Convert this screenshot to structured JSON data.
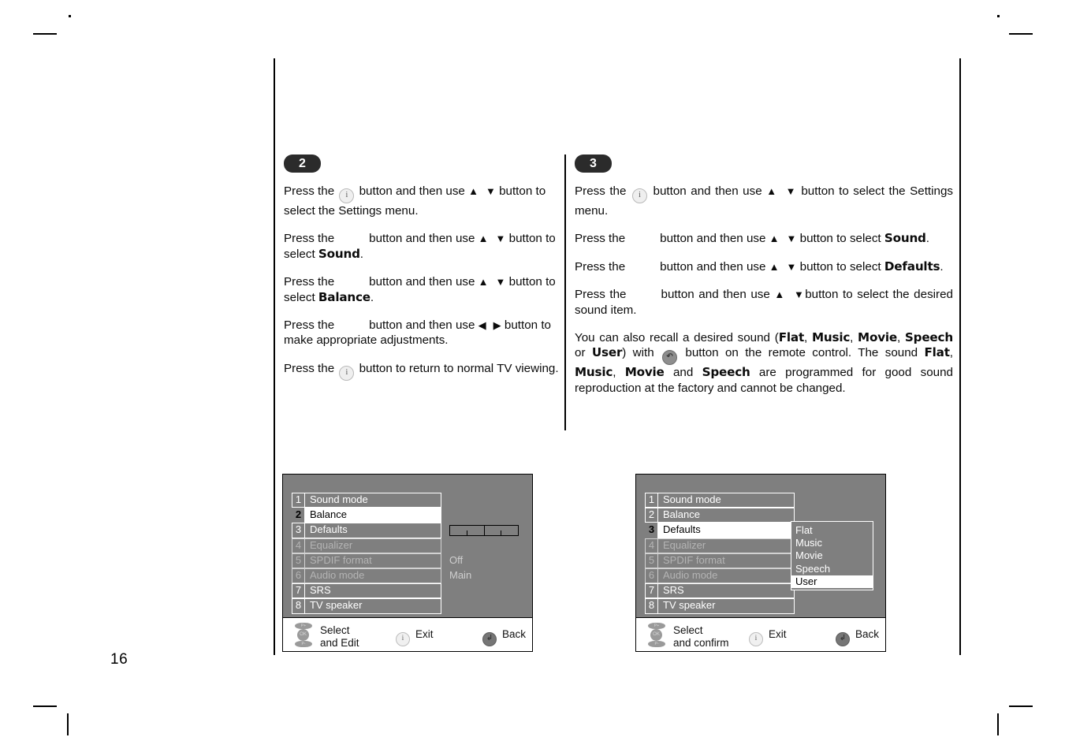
{
  "page": {
    "number": "16"
  },
  "steps": [
    {
      "badge": "2",
      "paragraphs": [
        {
          "id": "s2p1",
          "segments": [
            {
              "t": "text",
              "v": "Press the "
            },
            {
              "t": "key",
              "v": "i"
            },
            {
              "t": "text",
              "v": " button and then use "
            },
            {
              "t": "arrow",
              "v": "▲"
            },
            {
              "t": "gap",
              "v": ""
            },
            {
              "t": "arrow",
              "v": "▼"
            },
            {
              "t": "text",
              "v": " button to select the Settings menu."
            }
          ]
        },
        {
          "id": "s2p2",
          "segments": [
            {
              "t": "text",
              "v": "Press the"
            },
            {
              "t": "blank",
              "v": ""
            },
            {
              "t": "text",
              "v": "button and then use "
            },
            {
              "t": "arrow",
              "v": "▲"
            },
            {
              "t": "gap",
              "v": ""
            },
            {
              "t": "arrow",
              "v": "▼"
            },
            {
              "t": "text",
              "v": " button to select "
            },
            {
              "t": "bold",
              "v": "Sound"
            },
            {
              "t": "text",
              "v": "."
            }
          ]
        },
        {
          "id": "s2p3",
          "segments": [
            {
              "t": "text",
              "v": "Press the"
            },
            {
              "t": "blank",
              "v": ""
            },
            {
              "t": "text",
              "v": "button and then use "
            },
            {
              "t": "arrow",
              "v": "▲"
            },
            {
              "t": "gap",
              "v": ""
            },
            {
              "t": "arrow",
              "v": "▼"
            },
            {
              "t": "text",
              "v": " button to select "
            },
            {
              "t": "bold",
              "v": "Balance"
            },
            {
              "t": "text",
              "v": "."
            }
          ]
        },
        {
          "id": "s2p4",
          "segments": [
            {
              "t": "text",
              "v": "Press the"
            },
            {
              "t": "blank",
              "v": ""
            },
            {
              "t": "text",
              "v": "button and then use "
            },
            {
              "t": "arrow",
              "v": "◀"
            },
            {
              "t": "gap",
              "v": ""
            },
            {
              "t": "arrow",
              "v": "▶"
            },
            {
              "t": "text",
              "v": " button to make appropriate adjustments."
            }
          ]
        },
        {
          "id": "s2p5",
          "segments": [
            {
              "t": "text",
              "v": "Press the "
            },
            {
              "t": "key",
              "v": "i"
            },
            {
              "t": "text",
              "v": " button to return to normal TV viewing."
            }
          ]
        }
      ]
    },
    {
      "badge": "3",
      "paragraphs": [
        {
          "id": "s3p1",
          "segments": [
            {
              "t": "text",
              "v": "Press the "
            },
            {
              "t": "key",
              "v": "i"
            },
            {
              "t": "text",
              "v": " button and then use "
            },
            {
              "t": "arrow",
              "v": "▲"
            },
            {
              "t": "gap",
              "v": ""
            },
            {
              "t": "arrow",
              "v": "▼"
            },
            {
              "t": "text",
              "v": " button to select the Settings menu."
            }
          ]
        },
        {
          "id": "s3p2",
          "segments": [
            {
              "t": "text",
              "v": "Press the"
            },
            {
              "t": "blank",
              "v": ""
            },
            {
              "t": "text",
              "v": "button and then use "
            },
            {
              "t": "arrow",
              "v": "▲"
            },
            {
              "t": "gap",
              "v": ""
            },
            {
              "t": "arrow",
              "v": "▼"
            },
            {
              "t": "text",
              "v": " button to select "
            },
            {
              "t": "bold",
              "v": "Sound"
            },
            {
              "t": "text",
              "v": "."
            }
          ]
        },
        {
          "id": "s3p3",
          "segments": [
            {
              "t": "text",
              "v": "Press the"
            },
            {
              "t": "blank",
              "v": ""
            },
            {
              "t": "text",
              "v": "button and then use "
            },
            {
              "t": "arrow",
              "v": "▲"
            },
            {
              "t": "gap",
              "v": ""
            },
            {
              "t": "arrow",
              "v": "▼"
            },
            {
              "t": "text",
              "v": " button to select "
            },
            {
              "t": "bold",
              "v": "Defaults"
            },
            {
              "t": "text",
              "v": "."
            }
          ]
        },
        {
          "id": "s3p4",
          "segments": [
            {
              "t": "text",
              "v": "Press the"
            },
            {
              "t": "blank",
              "v": ""
            },
            {
              "t": "text",
              "v": "button and then use "
            },
            {
              "t": "arrow",
              "v": "▲"
            },
            {
              "t": "gap",
              "v": ""
            },
            {
              "t": "arrow",
              "v": "▼"
            },
            {
              "t": "text",
              "v": "button to select the desired sound item."
            }
          ]
        },
        {
          "id": "s3p5",
          "segments": [
            {
              "t": "text",
              "v": "You can also recall a desired sound ("
            },
            {
              "t": "bold",
              "v": "Flat"
            },
            {
              "t": "text",
              "v": ", "
            },
            {
              "t": "bold",
              "v": "Music"
            },
            {
              "t": "text",
              "v": ", "
            },
            {
              "t": "bold",
              "v": "Movie"
            },
            {
              "t": "text",
              "v": ", "
            },
            {
              "t": "bold",
              "v": "Speech"
            },
            {
              "t": "text",
              "v": " or "
            },
            {
              "t": "bold",
              "v": "User"
            },
            {
              "t": "text",
              "v": ") with "
            },
            {
              "t": "keydark",
              "v": "↶"
            },
            {
              "t": "text",
              "v": " button on the remote control. The sound "
            },
            {
              "t": "bold",
              "v": "Flat"
            },
            {
              "t": "text",
              "v": ", "
            },
            {
              "t": "bold",
              "v": "Music"
            },
            {
              "t": "text",
              "v": ", "
            },
            {
              "t": "bold",
              "v": "Movie"
            },
            {
              "t": "text",
              "v": " and "
            },
            {
              "t": "bold",
              "v": "Speech"
            },
            {
              "t": "text",
              "v": " are programmed for good sound reproduction at the factory and cannot be changed."
            }
          ]
        }
      ]
    }
  ],
  "osd_left": {
    "rows": [
      {
        "num": "1",
        "label": "Sound mode",
        "state": "normal",
        "value": ""
      },
      {
        "num": "2",
        "label": "Balance",
        "state": "selected",
        "value": ""
      },
      {
        "num": "3",
        "label": "Defaults",
        "state": "normal",
        "value": ""
      },
      {
        "num": "4",
        "label": "Equalizer",
        "state": "dim",
        "value": ""
      },
      {
        "num": "5",
        "label": "SPDIF format",
        "state": "dim",
        "value": "Off"
      },
      {
        "num": "6",
        "label": "Audio mode",
        "state": "dim",
        "value": "Main"
      },
      {
        "num": "7",
        "label": "SRS",
        "state": "normal",
        "value": ""
      },
      {
        "num": "8",
        "label": "TV speaker",
        "state": "normal",
        "value": ""
      }
    ],
    "balance_slider": {
      "position": "center",
      "ticks": 2
    },
    "bar": {
      "select_line1": "Select",
      "select_line2": "and Edit",
      "exit": "Exit",
      "back": "Back",
      "navpad_up": "P+",
      "navpad_ok": "OK",
      "navpad_down": "P-"
    }
  },
  "osd_right": {
    "rows": [
      {
        "num": "1",
        "label": "Sound mode",
        "state": "normal",
        "value": ""
      },
      {
        "num": "2",
        "label": "Balance",
        "state": "normal",
        "value": ""
      },
      {
        "num": "3",
        "label": "Defaults",
        "state": "selected",
        "value": ""
      },
      {
        "num": "4",
        "label": "Equalizer",
        "state": "dim",
        "value": ""
      },
      {
        "num": "5",
        "label": "SPDIF format",
        "state": "dim",
        "value": ""
      },
      {
        "num": "6",
        "label": "Audio mode",
        "state": "dim",
        "value": ""
      },
      {
        "num": "7",
        "label": "SRS",
        "state": "normal",
        "value": ""
      },
      {
        "num": "8",
        "label": "TV speaker",
        "state": "normal",
        "value": ""
      }
    ],
    "popup": {
      "items": [
        {
          "label": "Flat",
          "selected": false
        },
        {
          "label": "Music",
          "selected": false
        },
        {
          "label": "Movie",
          "selected": false
        },
        {
          "label": "Speech",
          "selected": false
        },
        {
          "label": "User",
          "selected": true
        }
      ]
    },
    "bar": {
      "select_line1": "Select",
      "select_line2": "and confirm",
      "exit": "Exit",
      "back": "Back",
      "navpad_up": "P+",
      "navpad_ok": "OK",
      "navpad_down": "P-"
    }
  },
  "colors": {
    "osd_background": "#7f7f7f",
    "osd_text": "#ffffff",
    "osd_dim_text": "#b4b4b4",
    "osd_selected_bg": "#ffffff",
    "osd_selected_text": "#000000",
    "badge_bg": "#2b2b2b"
  }
}
